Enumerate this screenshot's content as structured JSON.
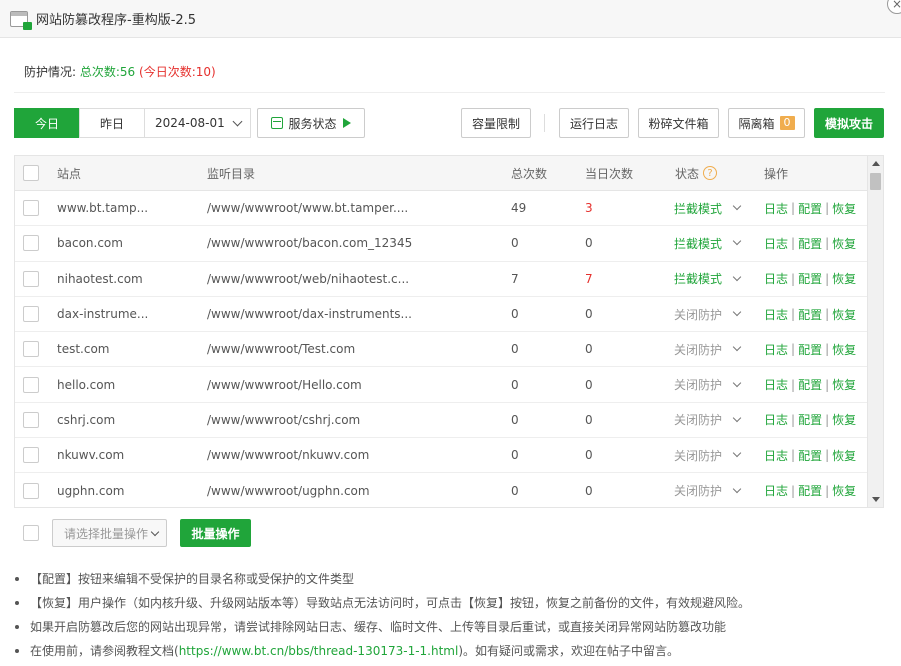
{
  "window": {
    "title": "网站防篡改程序-重构版-2.5",
    "close_glyph": "×"
  },
  "summary": {
    "label": "防护情况:",
    "total": "总次数:56",
    "today": "(今日次数:10)"
  },
  "toolbar": {
    "today": "今日",
    "yesterday": "昨日",
    "date": "2024-08-01",
    "service_status": "服务状态",
    "capacity_limit": "容量限制",
    "run_log": "运行日志",
    "shred_box": "粉碎文件箱",
    "quarantine": "隔离箱",
    "quarantine_count": "0",
    "simulate_attack": "模拟攻击"
  },
  "table": {
    "headers": {
      "site": "站点",
      "dir": "监听目录",
      "total": "总次数",
      "today": "当日次数",
      "status": "状态",
      "help_glyph": "?",
      "ops": "操作"
    },
    "ops": {
      "log": "日志",
      "config": "配置",
      "restore": "恢复",
      "sep": "|"
    },
    "rows": [
      {
        "site": "www.bt.tamp...",
        "dir": "/www/wwwroot/www.bt.tamper....",
        "total": "49",
        "today": "3",
        "status": "拦截模式"
      },
      {
        "site": "bacon.com",
        "dir": "/www/wwwroot/bacon.com_12345",
        "total": "0",
        "today": "0",
        "status": "拦截模式"
      },
      {
        "site": "nihaotest.com",
        "dir": "/www/wwwroot/web/nihaotest.c...",
        "total": "7",
        "today": "7",
        "status": "拦截模式"
      },
      {
        "site": "dax-instrume...",
        "dir": "/www/wwwroot/dax-instruments...",
        "total": "0",
        "today": "0",
        "status": "关闭防护"
      },
      {
        "site": "test.com",
        "dir": "/www/wwwroot/Test.com",
        "total": "0",
        "today": "0",
        "status": "关闭防护"
      },
      {
        "site": "hello.com",
        "dir": "/www/wwwroot/Hello.com",
        "total": "0",
        "today": "0",
        "status": "关闭防护"
      },
      {
        "site": "cshrj.com",
        "dir": "/www/wwwroot/cshrj.com",
        "total": "0",
        "today": "0",
        "status": "关闭防护"
      },
      {
        "site": "nkuwv.com",
        "dir": "/www/wwwroot/nkuwv.com",
        "total": "0",
        "today": "0",
        "status": "关闭防护"
      },
      {
        "site": "ugphn.com",
        "dir": "/www/wwwroot/ugphn.com",
        "total": "0",
        "today": "0",
        "status": "关闭防护"
      }
    ]
  },
  "batch": {
    "placeholder": "请选择批量操作",
    "button": "批量操作"
  },
  "notes": {
    "n1": "【配置】按钮来编辑不受保护的目录名称或受保护的文件类型",
    "n2": "【恢复】用户操作（如内核升级、升级网站版本等）导致站点无法访问时，可点击【恢复】按钮，恢复之前备份的文件，有效规避风险。",
    "n3": "如果开启防篡改后您的网站出现异常，请尝试排除网站日志、缓存、临时文件、上传等目录后重试，或直接关闭异常网站防篡改功能",
    "n4_prefix": "在使用前，请参阅教程文档(",
    "n4_link": "https://www.bt.cn/bbs/thread-130173-1-1.html",
    "n4_suffix": ")。如有疑问或需求，欢迎在帖子中留言。"
  },
  "colors": {
    "accent": "#20a53a",
    "danger": "#e5302d",
    "warning": "#f0ad4e"
  },
  "icons": {
    "window": "window-lock-icon",
    "service": "service-status-icon",
    "play": "play-icon",
    "help": "help-icon"
  }
}
